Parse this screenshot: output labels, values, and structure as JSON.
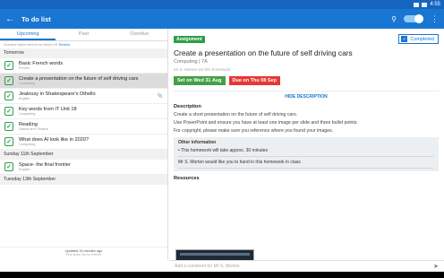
{
  "status": {
    "time": "4:55"
  },
  "appbar": {
    "title": "To do list",
    "back_icon": "back-arrow-icon",
    "search_icon": "search-icon"
  },
  "tabs": [
    {
      "label": "Upcoming"
    },
    {
      "label": "Past"
    },
    {
      "label": "Overdue"
    }
  ],
  "notice": {
    "text": "Overdue tasks need to be ticked off.",
    "link": "Review"
  },
  "sections": [
    {
      "label": "Tomorrow"
    },
    {
      "label": "Sunday 11th September"
    },
    {
      "label": "Tuesday 13th September"
    }
  ],
  "items": [
    {
      "title": "Basic French words",
      "subject": "French"
    },
    {
      "title": "Create a presentation on the future of self driving cars",
      "subject": "Computing"
    },
    {
      "title": "Jealousy in Shakespeare's Othello",
      "subject": "English"
    },
    {
      "title": "Key words from IT Unit 18",
      "subject": "Computing"
    },
    {
      "title": "Reading",
      "subject": "Drama and Theatre"
    },
    {
      "title": "What does AI look like in 2020?",
      "subject": "Computing"
    },
    {
      "title": "Space- the final frontier",
      "subject": "English"
    }
  ],
  "updated": {
    "text": "Updated 16 minutes ago",
    "sub": "Pull down list to refresh"
  },
  "detail": {
    "badge": "Assignment",
    "completed": "Completed",
    "title": "Create a presentation on the future of self driving cars",
    "subject": "Computing | 7A",
    "set_by": "Mr S. Morton set this homework",
    "set_on": "Set on Wed 31 Aug",
    "due_on": "Due on Thu 08 Sep",
    "hide_label": "HIDE DESCRIPTION",
    "desc_heading": "Description",
    "desc": [
      "Create a short presentation on the future of self driving cars.",
      "Use PowerPoint and ensure you have at least one image per slide and three bullet points.",
      "For copyright, please make sure you reference where you found your images."
    ],
    "other_heading": "Other information",
    "other": [
      "• This homework will take approx. 30 minutes",
      "Mr S. Morton would like you to hand in this homework in class"
    ],
    "resources_heading": "Resources"
  },
  "comment": {
    "placeholder": "Add a comment for Mr S. Morton"
  },
  "colors": {
    "primary": "#1976d2",
    "done": "#2e9d48",
    "due": "#e53935"
  }
}
